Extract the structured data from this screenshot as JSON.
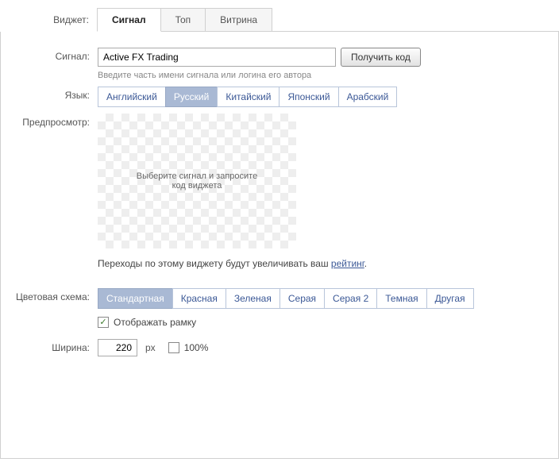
{
  "header": {
    "widget_label": "Виджет:",
    "tabs": [
      {
        "label": "Сигнал",
        "active": true
      },
      {
        "label": "Топ",
        "active": false
      },
      {
        "label": "Витрина",
        "active": false
      }
    ]
  },
  "form": {
    "signal": {
      "label": "Сигнал:",
      "value": "Active FX Trading",
      "button": "Получить код",
      "hint": "Введите часть имени сигнала или логина его автора"
    },
    "language": {
      "label": "Язык:",
      "options": [
        {
          "label": "Английский",
          "active": false
        },
        {
          "label": "Русский",
          "active": true
        },
        {
          "label": "Китайский",
          "active": false
        },
        {
          "label": "Японский",
          "active": false
        },
        {
          "label": "Арабский",
          "active": false
        }
      ]
    },
    "preview": {
      "label": "Предпросмотр:",
      "placeholder": "Выберите сигнал и запросите код виджета",
      "info_prefix": "Переходы по этому виджету будут увеличивать ваш ",
      "info_link": "рейтинг",
      "info_suffix": "."
    },
    "color_scheme": {
      "label": "Цветовая схема:",
      "options": [
        {
          "label": "Стандартная",
          "active": true
        },
        {
          "label": "Красная",
          "active": false
        },
        {
          "label": "Зеленая",
          "active": false
        },
        {
          "label": "Серая",
          "active": false
        },
        {
          "label": "Серая 2",
          "active": false
        },
        {
          "label": "Темная",
          "active": false
        },
        {
          "label": "Другая",
          "active": false
        }
      ],
      "show_frame_label": "Отображать рамку",
      "show_frame_checked": true
    },
    "width": {
      "label": "Ширина:",
      "value": "220",
      "unit": "px",
      "full_label": "100%",
      "full_checked": false
    }
  }
}
